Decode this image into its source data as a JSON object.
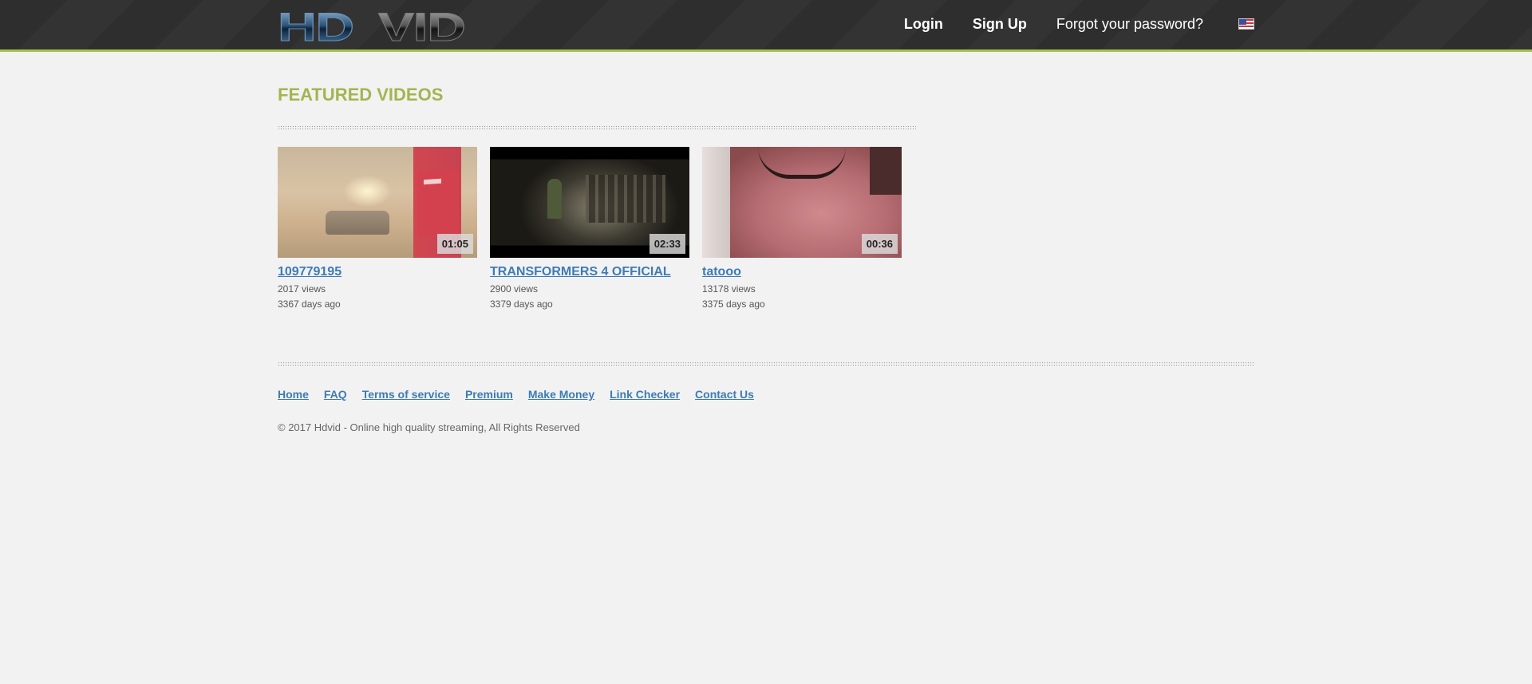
{
  "header": {
    "logo_text_a": "HD",
    "logo_text_b": "VID",
    "nav": {
      "login": "Login",
      "signup": "Sign Up",
      "forgot": "Forgot your password?"
    },
    "language_icon": "us-flag-icon"
  },
  "main": {
    "section_title": "FEATURED VIDEOS",
    "videos": [
      {
        "title": "109779195",
        "duration": "01:05",
        "views": "2017 views",
        "age": "3367 days ago"
      },
      {
        "title": "TRANSFORMERS 4 OFFICIAL",
        "duration": "02:33",
        "views": "2900 views",
        "age": "3379 days ago"
      },
      {
        "title": "tatooo",
        "duration": "00:36",
        "views": "13178 views",
        "age": "3375 days ago"
      }
    ]
  },
  "footer": {
    "links": [
      "Home",
      "FAQ",
      "Terms of service",
      "Premium",
      "Make Money",
      "Link Checker",
      "Contact Us"
    ],
    "copyright": "© 2017 Hdvid - Online high quality streaming, All Rights Reserved"
  },
  "colors": {
    "accent_green": "#a3b54f",
    "link_blue": "#3d7bb5",
    "header_bg": "#2e2e2e",
    "page_bg": "#f2f2f2"
  }
}
